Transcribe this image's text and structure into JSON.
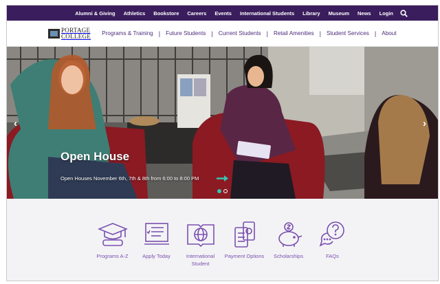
{
  "utility_nav": {
    "items": [
      "Alumni & Giving",
      "Athletics",
      "Bookstore",
      "Careers",
      "Events",
      "International Students",
      "Library",
      "Museum",
      "News",
      "Login"
    ],
    "search_icon": "search-icon"
  },
  "logo": {
    "line1": "PORTAGE",
    "line2": "COLLEGE"
  },
  "main_nav": {
    "items": [
      "Programs & Training",
      "Future Students",
      "Current Students",
      "Retail Amenities",
      "Student Services",
      "About"
    ]
  },
  "hero": {
    "title": "Open House",
    "subtitle": "Open Houses November 6th, 7th & 8th from 6:00 to 8:00 PM",
    "prev_icon": "chevron-left-icon",
    "next_icon": "chevron-right-icon",
    "slide_count": 2,
    "active_slide": 1
  },
  "quick_links": [
    {
      "label": "Programs A-Z",
      "icon": "graduation-cap-icon"
    },
    {
      "label": "Apply Today",
      "icon": "application-form-icon"
    },
    {
      "label": "International Student",
      "icon": "globe-book-icon"
    },
    {
      "label": "Payment Options",
      "icon": "payment-money-icon"
    },
    {
      "label": "Scholarships",
      "icon": "piggy-bank-icon"
    },
    {
      "label": "FAQs",
      "icon": "question-bubble-icon"
    }
  ],
  "colors": {
    "utility_bg": "#3a1d5c",
    "nav_text": "#4a2a7a",
    "icon_purple": "#7a4fb0",
    "accent_teal": "#39c3b1"
  }
}
